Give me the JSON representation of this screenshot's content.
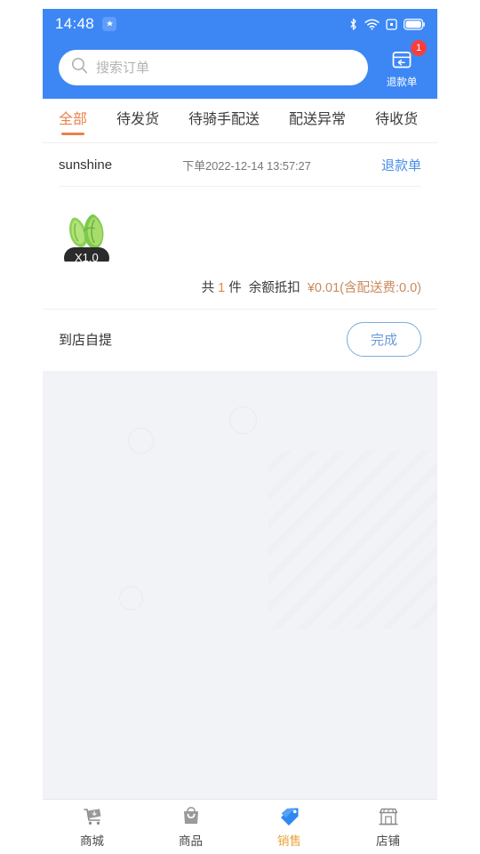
{
  "statusbar": {
    "time": "14:48",
    "chip_icon": "app-badge-icon",
    "icons": [
      "bluetooth-icon",
      "wifi-icon",
      "sim-icon",
      "battery-icon"
    ]
  },
  "header": {
    "search": {
      "placeholder": "搜索订单",
      "value": "",
      "icon": "search-icon"
    },
    "refund": {
      "label": "退款单",
      "icon": "refund-box-icon",
      "badge": "1",
      "badge_color": "#f53f3f"
    },
    "background_color": "#3d87f5"
  },
  "tabs": {
    "active_index": 0,
    "accent_color": "#e8824a",
    "items": [
      {
        "label": "全部"
      },
      {
        "label": "待发货"
      },
      {
        "label": "待骑手配送"
      },
      {
        "label": "配送异常"
      },
      {
        "label": "待收货"
      }
    ]
  },
  "orders": [
    {
      "buyer": "sunshine",
      "order_time": "下单2022-12-14 13:57:27",
      "refund_link": "退款单",
      "goods": [
        {
          "name": "lettuce-thumbnail",
          "quantity_label": "X1.0"
        }
      ],
      "summary": {
        "prefix": "共",
        "count": "1",
        "unit": "件",
        "payment_method": "余额抵扣",
        "price": "¥0.01(含配送费:0.0)"
      },
      "delivery_type": "到店自提",
      "action_button": "完成"
    }
  ],
  "tabbar": {
    "active_index": 2,
    "active_color": "#e8a33a",
    "items": [
      {
        "label": "商城",
        "icon": "shopping-cart-icon"
      },
      {
        "label": "商品",
        "icon": "shopping-bag-icon"
      },
      {
        "label": "销售",
        "icon": "price-tag-icon"
      },
      {
        "label": "店铺",
        "icon": "storefront-icon"
      }
    ]
  }
}
